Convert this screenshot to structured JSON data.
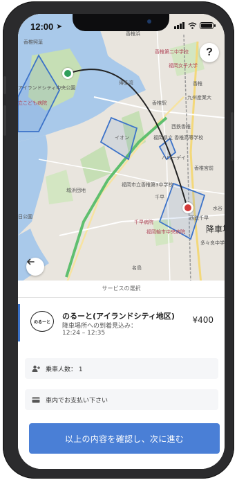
{
  "status_bar": {
    "time": "12:00"
  },
  "map": {
    "labels": {
      "l1": "香椎照葉",
      "l2": "香椎浜",
      "l3": "香椎第二中学校",
      "l4": "福岡女子大学",
      "l5": "アイランドシティ中央公園",
      "l6": "立こども病院",
      "l7": "博多湾",
      "l8": "香椎駅",
      "l9": "九州産業大",
      "l10": "西鉄香椎",
      "l11": "福岡県立 香椎高等学校",
      "l12": "イオン",
      "l13": "ハローデイ",
      "l14": "香椎宮前",
      "l15": "城浜団地",
      "l16": "福岡市立香椎第3中学校",
      "l17": "千早",
      "l18": "西鉄千早",
      "l19": "千早病院",
      "l20": "福岡輸市中央病院",
      "l21": "降車場",
      "l22": "名島",
      "l23": "多々良中学校",
      "l24": "水谷",
      "l25": "香椎",
      "l26": "日公園"
    },
    "help_label": "?",
    "accent_color": "#3b72c9",
    "route_color": "#222222",
    "origin_pin_color": "#2f9e5a",
    "destination_pin_color": "#d33a3a"
  },
  "sheet": {
    "title": "サービスの選択",
    "service": {
      "logo_text": "のるーと",
      "name": "のるーと(アイランドシティ地区)",
      "subtitle": "降車場所への到着見込み：",
      "time_range": "12:24 – 12:35",
      "price": "¥400"
    },
    "passengers_label": "乗車人数： 1",
    "payment_label": "車内でお支払い下さい",
    "confirm_label": "以上の内容を確認し、次に進む"
  },
  "icons": {
    "help": "help-icon",
    "back": "back-arrow-icon",
    "passengers": "add-person-icon",
    "payment": "card-icon"
  }
}
